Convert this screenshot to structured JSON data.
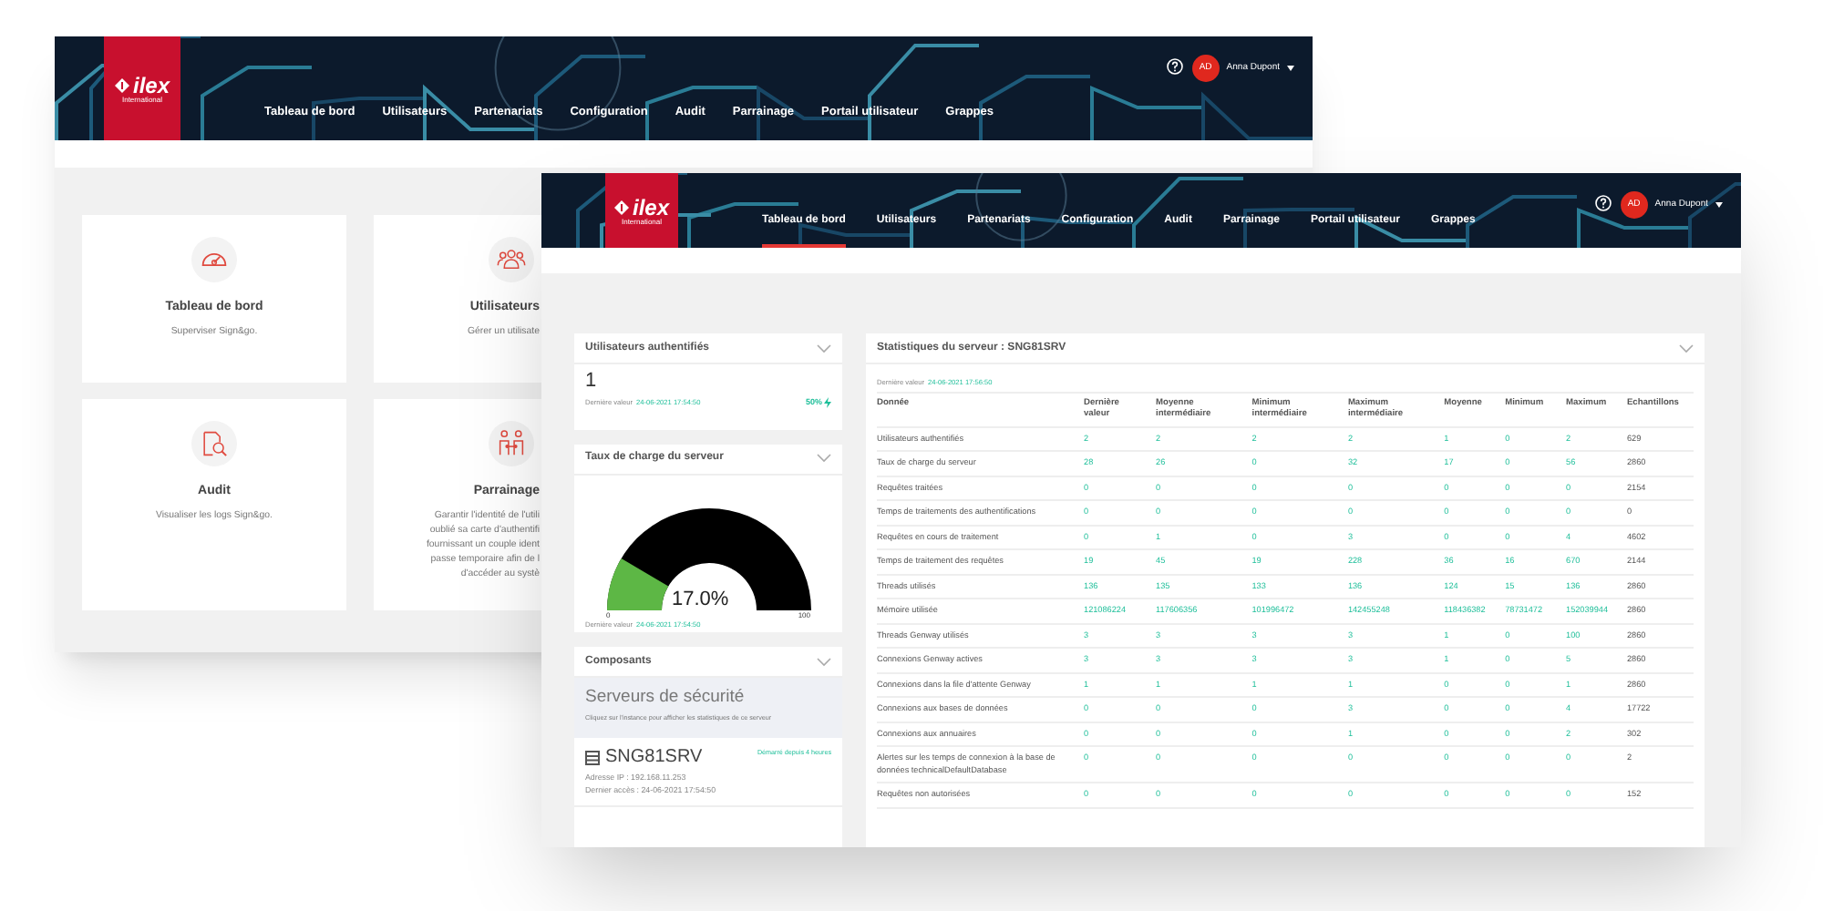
{
  "back_window": {
    "logo": {
      "name": "ilex",
      "tagline": "International"
    },
    "nav": [
      {
        "label": "Tableau de bord",
        "selected": false
      },
      {
        "label": "Utilisateurs",
        "selected": false
      },
      {
        "label": "Partenariats",
        "selected": false
      },
      {
        "label": "Configuration",
        "selected": false
      },
      {
        "label": "Audit",
        "selected": false
      },
      {
        "label": "Parrainage",
        "selected": false
      },
      {
        "label": "Portail utilisateur",
        "selected": false
      },
      {
        "label": "Grappes",
        "selected": false
      }
    ],
    "user": {
      "initials": "AD",
      "name": "Anna Dupont"
    },
    "cards": [
      {
        "kind": "dashboard",
        "title": "Tableau de bord",
        "description": [
          "Superviser Sign&go."
        ]
      },
      {
        "kind": "users",
        "title": "Utilisateurs",
        "description": [
          "Gérer un utilisate"
        ]
      },
      {
        "kind": "audit",
        "title": "Audit",
        "description": [
          "Visualiser les logs Sign&go."
        ]
      },
      {
        "kind": "sponsor",
        "title": "Parrainage",
        "description": [
          "Garantir l'identité de l'utili",
          "oublié sa carte d'authentifi",
          "fournissant un couple ident",
          "passe temporaire afin de l",
          "d'accéder au systè"
        ]
      }
    ]
  },
  "front_window": {
    "logo": {
      "name": "ilex",
      "tagline": "International"
    },
    "nav": [
      {
        "label": "Tableau de bord",
        "selected": true
      },
      {
        "label": "Utilisateurs",
        "selected": false
      },
      {
        "label": "Partenariats",
        "selected": false
      },
      {
        "label": "Configuration",
        "selected": false
      },
      {
        "label": "Audit",
        "selected": false
      },
      {
        "label": "Parrainage",
        "selected": false
      },
      {
        "label": "Portail utilisateur",
        "selected": false
      },
      {
        "label": "Grappes",
        "selected": false
      }
    ],
    "user": {
      "initials": "AD",
      "name": "Anna Dupont"
    },
    "auth_users": {
      "title": "Utilisateurs authentifiés",
      "value": "1",
      "last_value_label": "Dernière valeur",
      "last_value_date": "24-06-2021 17:54:50",
      "trend": "50%"
    },
    "server_load": {
      "title": "Taux de charge du serveur",
      "level": 0.17,
      "reading": "17.0%",
      "min": "0",
      "max": "100",
      "last_value_label": "Dernière valeur",
      "last_value_date": "24-06-2021 17:54:50"
    },
    "components": {
      "title": "Composants",
      "section_title": "Serveurs de sécurité",
      "hint": "Cliquez sur l'instance pour afficher les statistiques de ce serveur",
      "server": {
        "name": "SNG81SRV",
        "status": "Démarré depuis 4 heures",
        "ip": "Adresse IP : 192.168.11.253",
        "last_access": "Dernier accès : 24-06-2021 17:54:50"
      }
    },
    "stats": {
      "title": "Statistiques du serveur : SNG81SRV",
      "last_value_label": "Dernière valeur",
      "last_value_date": "24-06-2021 17:56:50",
      "columns": [
        "Donnée",
        "Dernière valeur",
        "Moyenne intermédiaire",
        "Minimum intermédiaire",
        "Maximum intermédiaire",
        "Moyenne",
        "Minimum",
        "Maximum",
        "Echantillons"
      ],
      "rows": [
        [
          "Utilisateurs authentifiés",
          "2",
          "2",
          "2",
          "2",
          "1",
          "0",
          "2",
          "629"
        ],
        [
          "Taux de charge du serveur",
          "28",
          "26",
          "0",
          "32",
          "17",
          "0",
          "56",
          "2860"
        ],
        [
          "Requêtes traitées",
          "0",
          "0",
          "0",
          "0",
          "0",
          "0",
          "0",
          "2154"
        ],
        [
          "Temps de traitements des authentifications",
          "0",
          "0",
          "0",
          "0",
          "0",
          "0",
          "0",
          "0"
        ],
        [
          "Requêtes en cours de traitement",
          "0",
          "1",
          "0",
          "3",
          "0",
          "0",
          "4",
          "4602"
        ],
        [
          "Temps de traitement des requêtes",
          "19",
          "45",
          "19",
          "228",
          "36",
          "16",
          "670",
          "2144"
        ],
        [
          "Threads utilisés",
          "136",
          "135",
          "133",
          "136",
          "124",
          "15",
          "136",
          "2860"
        ],
        [
          "Mémoire utilisée",
          "121086224",
          "117606356",
          "101996472",
          "142455248",
          "118436382",
          "78731472",
          "152039944",
          "2860"
        ],
        [
          "Threads Genway utilisés",
          "3",
          "3",
          "3",
          "3",
          "1",
          "0",
          "100",
          "2860"
        ],
        [
          "Connexions Genway actives",
          "3",
          "3",
          "3",
          "3",
          "1",
          "0",
          "5",
          "2860"
        ],
        [
          "Connexions dans la file d'attente Genway",
          "1",
          "1",
          "1",
          "1",
          "0",
          "0",
          "1",
          "2860"
        ],
        [
          "Connexions aux bases de données",
          "0",
          "0",
          "0",
          "3",
          "0",
          "0",
          "4",
          "17722"
        ],
        [
          "Connexions aux annuaires",
          "0",
          "0",
          "0",
          "1",
          "0",
          "0",
          "2",
          "302"
        ],
        [
          "Alertes sur les temps de connexion à la base de données technicalDefaultDatabase",
          "0",
          "0",
          "0",
          "0",
          "0",
          "0",
          "0",
          "2"
        ],
        [
          "Requêtes non autorisées",
          "0",
          "0",
          "0",
          "0",
          "0",
          "0",
          "0",
          "152"
        ]
      ]
    }
  }
}
